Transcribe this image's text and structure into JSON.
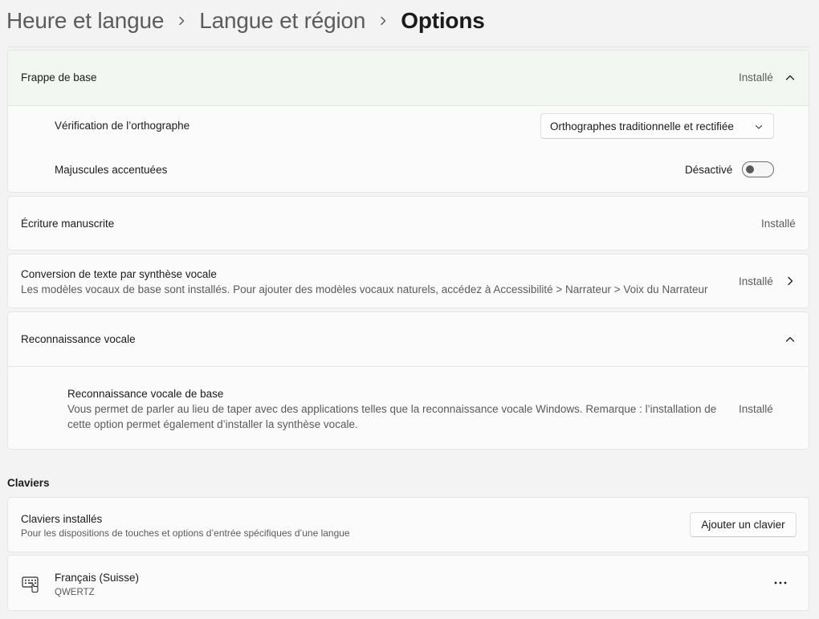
{
  "breadcrumb": [
    "Heure et langue",
    "Langue et région",
    "Options"
  ],
  "basic_typing": {
    "title": "Frappe de base",
    "status": "Installé",
    "spellcheck": {
      "label": "Vérification de l’orthographe",
      "selected": "Orthographes traditionnelle et rectifiée"
    },
    "accented_caps": {
      "label": "Majuscules accentuées",
      "state": "Désactivé",
      "on": false
    }
  },
  "handwriting": {
    "title": "Écriture manuscrite",
    "status": "Installé"
  },
  "tts": {
    "title": "Conversion de texte par synthèse vocale",
    "description": "Les modèles vocaux de base sont installés. Pour ajouter des modèles vocaux naturels, accédez à Accessibilité > Narrateur > Voix du Narrateur",
    "status": "Installé"
  },
  "speech": {
    "title": "Reconnaissance vocale",
    "basic": {
      "title": "Reconnaissance vocale de base",
      "description": "Vous permet de parler au lieu de taper avec des applications telles que la reconnaissance vocale Windows. Remarque : l’installation de cette option permet également d’installer la synthèse vocale.",
      "status": "Installé"
    }
  },
  "keyboards": {
    "section_title": "Claviers",
    "installed": {
      "title": "Claviers installés",
      "description": "Pour les dispositions de touches et options d’entrée spécifiques d’une langue",
      "button": "Ajouter un clavier"
    },
    "items": [
      {
        "name": "Français (Suisse)",
        "layout": "QWERTZ",
        "icon": "keyboard-icon"
      }
    ]
  },
  "colors": {
    "expanded_header": "#f2f7f2",
    "card": "#fbfbfb",
    "page": "#f3f3f3"
  }
}
